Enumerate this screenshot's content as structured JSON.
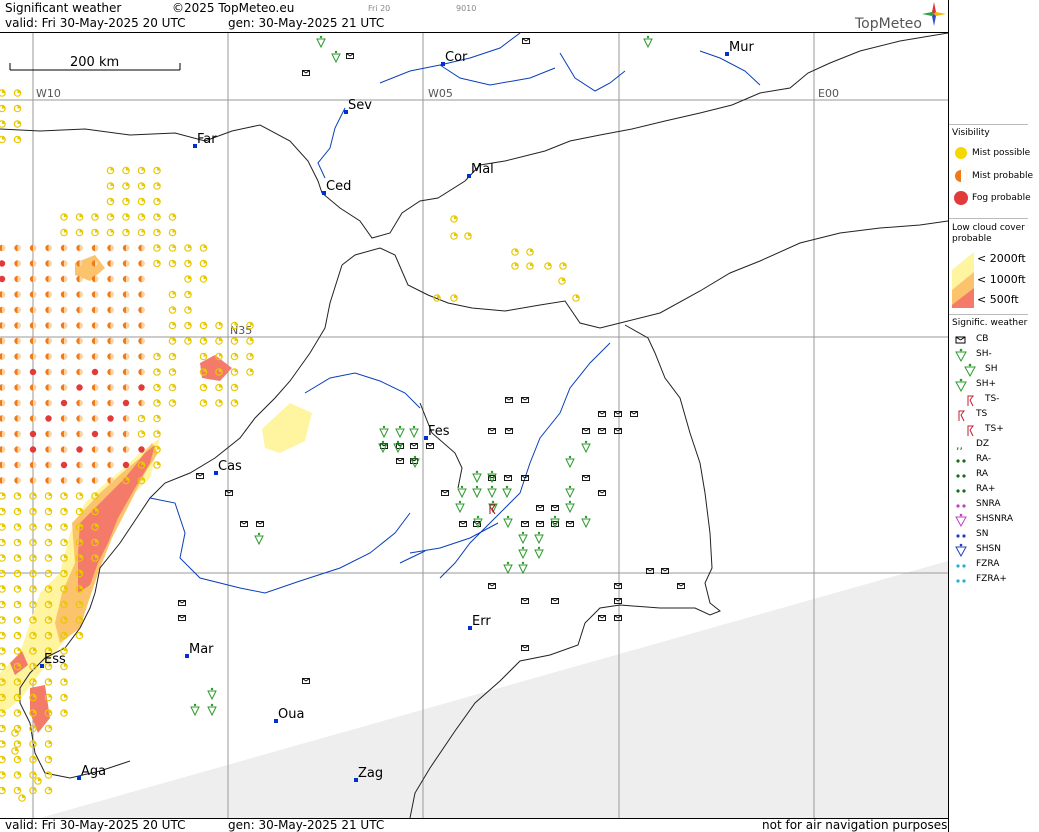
{
  "header": {
    "title": "Significant weather",
    "copyright": "©2025 TopMeteo.eu",
    "tag1": "Fri 20",
    "tag2": "9010",
    "valid_label": "valid:  Fri  30-May-2025  20 UTC",
    "gen_label": "gen: 30-May-2025 21 UTC",
    "brand": "TopMeteo"
  },
  "map": {
    "scale_label": "200 km",
    "grid_labels": [
      "W10",
      "W05",
      "E00",
      "N35"
    ],
    "cities": [
      {
        "name": "Cor"
      },
      {
        "name": "Mur"
      },
      {
        "name": "Sev"
      },
      {
        "name": "Far"
      },
      {
        "name": "Mal"
      },
      {
        "name": "Ced"
      },
      {
        "name": "Fes"
      },
      {
        "name": "Cas"
      },
      {
        "name": "Err"
      },
      {
        "name": "Mar"
      },
      {
        "name": "Ess"
      },
      {
        "name": "Oua"
      },
      {
        "name": "Aga"
      },
      {
        "name": "Zag"
      }
    ]
  },
  "legend": {
    "visibility_title": "Visibility",
    "visibility_items": [
      {
        "label": "Mist possible",
        "color": "#f5d800"
      },
      {
        "label": "Mist probable",
        "color": "#f07a1a"
      },
      {
        "label": "Fog probable",
        "color": "#e03a3a"
      }
    ],
    "lowcloud_title_1": "Low cloud cover",
    "lowcloud_title_2": "probable",
    "lowcloud_items": [
      {
        "label": "< 2000ft",
        "color": "#fff4a0"
      },
      {
        "label": "< 1000ft",
        "color": "#fbc36b"
      },
      {
        "label": "<   500ft",
        "color": "#f47a6a"
      }
    ],
    "weather_title": "Signific. weather",
    "weather_items": [
      {
        "label": "CB",
        "icon": "cb-icon"
      },
      {
        "label": "SH-",
        "icon": "shower-light-icon"
      },
      {
        "label": "SH",
        "icon": "shower-icon"
      },
      {
        "label": "SH+",
        "icon": "shower-heavy-icon"
      },
      {
        "label": "TS-",
        "icon": "thunderstorm-light-icon"
      },
      {
        "label": "TS",
        "icon": "thunderstorm-icon"
      },
      {
        "label": "TS+",
        "icon": "thunderstorm-heavy-icon"
      },
      {
        "label": "DZ",
        "icon": "drizzle-icon"
      },
      {
        "label": "RA-",
        "icon": "rain-light-icon"
      },
      {
        "label": "RA",
        "icon": "rain-icon"
      },
      {
        "label": "RA+",
        "icon": "rain-heavy-icon"
      },
      {
        "label": "SNRA",
        "icon": "snow-rain-icon"
      },
      {
        "label": "SHSNRA",
        "icon": "snow-rain-shower-icon"
      },
      {
        "label": "SN",
        "icon": "snow-icon"
      },
      {
        "label": "SHSN",
        "icon": "snow-shower-icon"
      },
      {
        "label": "FZRA",
        "icon": "freezing-rain-icon"
      },
      {
        "label": "FZRA+",
        "icon": "freezing-rain-heavy-icon"
      }
    ]
  },
  "footer": {
    "valid_label": "valid:  Fri  30-May-2025  20 UTC",
    "gen_label": "gen: 30-May-2025 21 UTC",
    "disclaimer": "not for air navigation purposes"
  }
}
